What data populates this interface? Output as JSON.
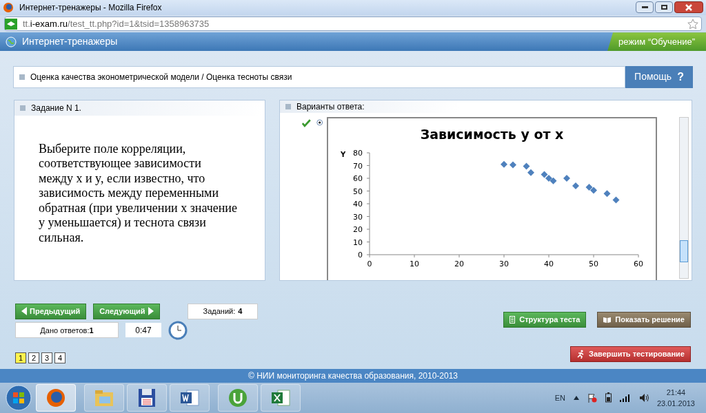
{
  "window": {
    "title": "Интернет-тренажеры - Mozilla Firefox"
  },
  "address_bar": {
    "host_prefix": "tt.",
    "host": "i-exam.ru",
    "path": "/test_tt.php?id=1&tsid=1358963735"
  },
  "app_header": {
    "title": "Интернет-тренажеры",
    "mode": "режим “Обучение”"
  },
  "breadcrumb": "Оценка качества эконометрической модели / Оценка тесноты связи",
  "help_button": "Помощь",
  "help_icon": "?",
  "task": {
    "heading": "Задание N 1.",
    "text": "Выберите поле корреляции, соответствующее зависимости между x и y, если известно, что зависимость между переменными обратная (при увеличении x значение y уменьшается) и теснота связи сильная."
  },
  "answers": {
    "heading": "Варианты ответа:",
    "options": [
      {
        "selected": true,
        "correct": true,
        "chart_data": {
          "type": "scatter",
          "title": "Зависимость y от x",
          "ylabel": "Y",
          "xlim": [
            0,
            60
          ],
          "ylim": [
            0,
            80
          ],
          "xticks": [
            0,
            10,
            20,
            30,
            40,
            50,
            60
          ],
          "yticks": [
            0,
            10,
            20,
            30,
            40,
            50,
            60,
            70,
            80
          ],
          "series": [
            {
              "color": "#4f81bd",
              "x": [
                30,
                32,
                35,
                36,
                39,
                40,
                41,
                44,
                46,
                49,
                50,
                53,
                55
              ],
              "values": [
                71,
                70.5,
                69.5,
                64.5,
                63,
                60,
                58,
                60,
                54,
                53,
                50.5,
                48,
                43
              ]
            }
          ]
        }
      }
    ]
  },
  "nav": {
    "prev": "Предыдущий",
    "next": "Следующий",
    "tasks_label": "Заданий:",
    "tasks_count": "4",
    "answered_label": "Дано ответов:",
    "answered_count": "1",
    "timer": "0:47"
  },
  "pages": [
    {
      "label": "1",
      "selected": true
    },
    {
      "label": "2",
      "selected": false
    },
    {
      "label": "3",
      "selected": false
    },
    {
      "label": "4",
      "selected": false
    }
  ],
  "actions": [
    {
      "label": "Структура теста",
      "kind": "structure"
    },
    {
      "label": "Показать решение",
      "kind": "solution"
    }
  ],
  "finish_button": "Завершить тестирование",
  "footer": "© НИИ мониторинга качества образования, 2010-2013",
  "taskbar": {
    "apps": [
      {
        "kind": "firefox",
        "selected": true
      },
      {
        "kind": "folder",
        "selected": false
      },
      {
        "kind": "floppy",
        "selected": false
      },
      {
        "kind": "word",
        "selected": false
      },
      {
        "kind": "torrent",
        "selected": false
      },
      {
        "kind": "excel",
        "selected": false
      }
    ],
    "language": "EN",
    "time": "21:44",
    "date": "23.01.2013"
  }
}
